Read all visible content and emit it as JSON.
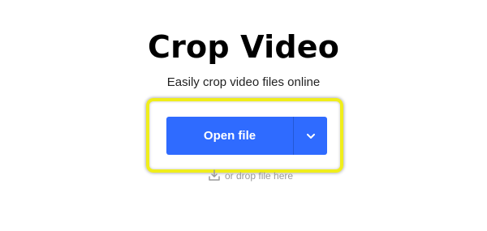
{
  "header": {
    "title": "Crop Video",
    "subtitle": "Easily crop video files online"
  },
  "upload": {
    "open_file_label": "Open file",
    "dropdown_icon": "chevron-down-icon",
    "drop_hint": "or drop file here",
    "drop_hint_icon": "download-tray-icon"
  },
  "colors": {
    "button_blue": "#2f6bff",
    "highlight_yellow": "#f0ee1b",
    "hint_gray": "#9a9a9a"
  }
}
